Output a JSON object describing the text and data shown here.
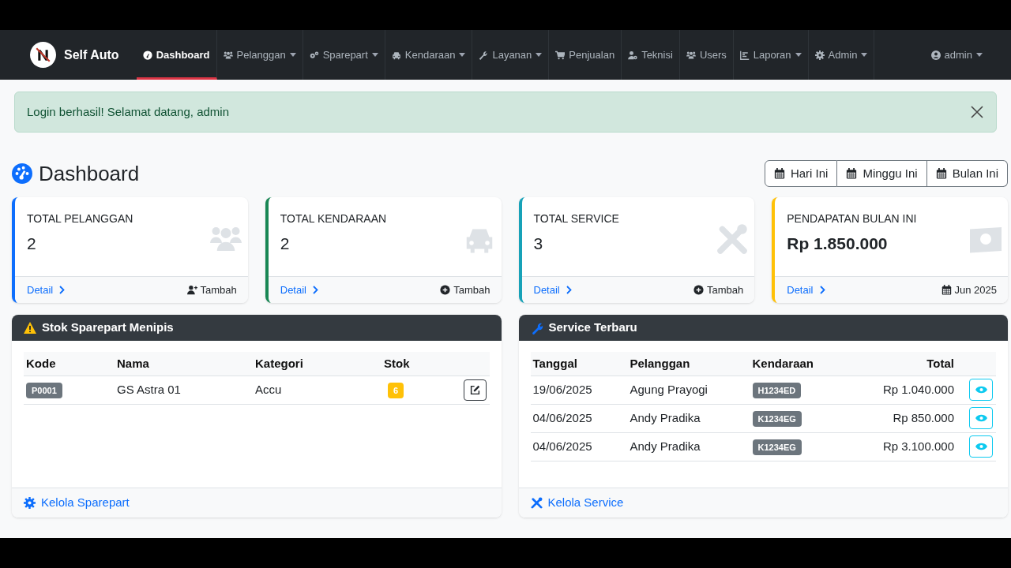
{
  "brand": {
    "name": "Self Auto"
  },
  "nav": [
    {
      "label": "Dashboard",
      "dropdown": false,
      "selected": true
    },
    {
      "label": "Pelanggan",
      "dropdown": true,
      "selected": false
    },
    {
      "label": "Sparepart",
      "dropdown": true,
      "selected": false
    },
    {
      "label": "Kendaraan",
      "dropdown": true,
      "selected": false
    },
    {
      "label": "Layanan",
      "dropdown": true,
      "selected": false
    },
    {
      "label": "Penjualan",
      "dropdown": false,
      "selected": false
    },
    {
      "label": "Teknisi",
      "dropdown": false,
      "selected": false
    },
    {
      "label": "Users",
      "dropdown": false,
      "selected": false
    },
    {
      "label": "Laporan",
      "dropdown": true,
      "selected": false
    },
    {
      "label": "Admin",
      "dropdown": true,
      "selected": false
    }
  ],
  "user_menu": {
    "label": "admin",
    "dropdown": true
  },
  "alert": {
    "message": "Login berhasil! Selamat datang, admin"
  },
  "page_title": "Dashboard",
  "range_buttons": [
    {
      "label": "Hari Ini"
    },
    {
      "label": "Minggu Ini"
    },
    {
      "label": "Bulan Ini"
    }
  ],
  "stat_cards": [
    {
      "title": "TOTAL PELANGGAN",
      "value": "2",
      "color": "#0d6efd",
      "link": "Detail",
      "action": "Tambah"
    },
    {
      "title": "TOTAL KENDARAAN",
      "value": "2",
      "color": "#198754",
      "link": "Detail",
      "action": "Tambah"
    },
    {
      "title": "TOTAL SERVICE",
      "value": "3",
      "color": "#17a2b8",
      "link": "Detail",
      "action": "Tambah"
    },
    {
      "title": "PENDAPATAN BULAN INI",
      "value": "Rp 1.850.000",
      "color": "#ffc107",
      "link": "Detail",
      "action": "Jun 2025"
    }
  ],
  "low_stock": {
    "title": "Stok Sparepart Menipis",
    "columns": [
      "Kode",
      "Nama",
      "Kategori",
      "Stok"
    ],
    "rows": [
      {
        "kode": "P0001",
        "nama": "GS Astra 01",
        "kategori": "Accu",
        "stok": "6"
      }
    ],
    "footer_link": "Kelola Sparepart"
  },
  "recent_services": {
    "title": "Service Terbaru",
    "columns": [
      "Tanggal",
      "Pelanggan",
      "Kendaraan",
      "Total"
    ],
    "rows": [
      {
        "tanggal": "19/06/2025",
        "pelanggan": "Agung Prayogi",
        "kendaraan": "H1234ED",
        "total": "Rp 1.040.000"
      },
      {
        "tanggal": "04/06/2025",
        "pelanggan": "Andy Pradika",
        "kendaraan": "K1234EG",
        "total": "Rp 850.000"
      },
      {
        "tanggal": "04/06/2025",
        "pelanggan": "Andy Pradika",
        "kendaraan": "K1234EG",
        "total": "Rp 3.100.000"
      }
    ],
    "footer_link": "Kelola Service"
  }
}
